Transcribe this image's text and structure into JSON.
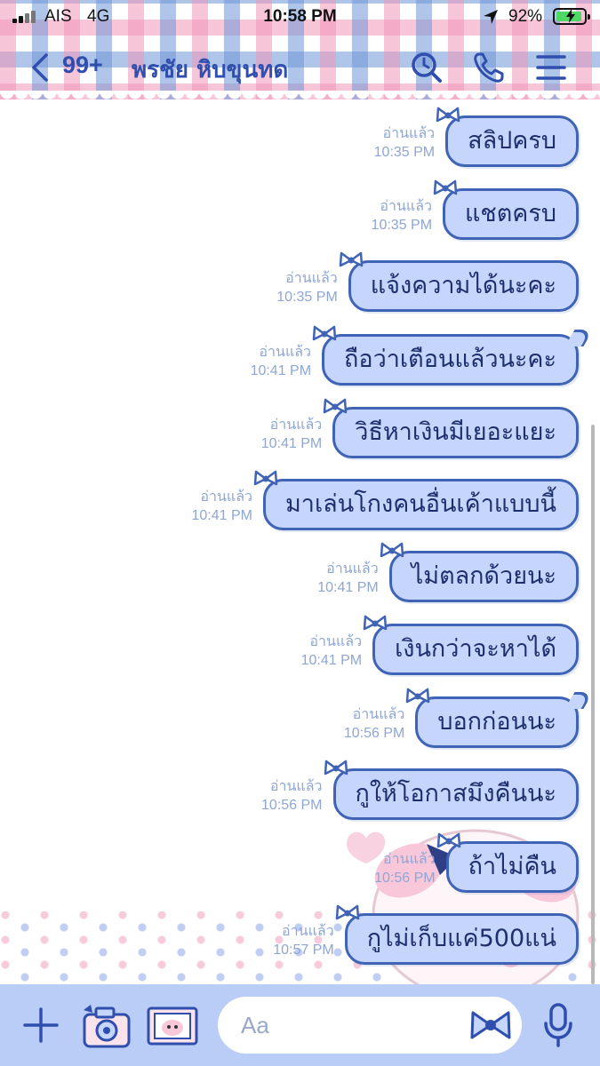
{
  "status_bar": {
    "carrier": "AIS",
    "network": "4G",
    "time": "10:58 PM",
    "battery": "92%",
    "battery_level": 0.92
  },
  "header": {
    "unread_count": "99+",
    "chat_title": "พรชัย หิบขุนทด"
  },
  "messages": [
    {
      "status": "อ่านแล้ว",
      "time": "10:35 PM",
      "text": "สลิปครบ"
    },
    {
      "status": "อ่านแล้ว",
      "time": "10:35 PM",
      "text": "แชตครบ"
    },
    {
      "status": "อ่านแล้ว",
      "time": "10:35 PM",
      "text": "แจ้งความได้นะคะ"
    },
    {
      "status": "อ่านแล้ว",
      "time": "10:41 PM",
      "text": "ถือว่าเตือนแล้วนะคะ"
    },
    {
      "status": "อ่านแล้ว",
      "time": "10:41 PM",
      "text": "วิธีหาเงินมีเยอะแยะ"
    },
    {
      "status": "อ่านแล้ว",
      "time": "10:41 PM",
      "text": "มาเล่นโกงคนอื่นเค้าแบบนี้"
    },
    {
      "status": "อ่านแล้ว",
      "time": "10:41 PM",
      "text": "ไม่ตลกด้วยนะ"
    },
    {
      "status": "อ่านแล้ว",
      "time": "10:41 PM",
      "text": "เงินกว่าจะหาได้"
    },
    {
      "status": "อ่านแล้ว",
      "time": "10:56 PM",
      "text": "บอกก่อนนะ"
    },
    {
      "status": "อ่านแล้ว",
      "time": "10:56 PM",
      "text": "กูให้โอกาสมึงคืนนะ"
    },
    {
      "status": "อ่านแล้ว",
      "time": "10:56 PM",
      "text": "ถ้าไม่คืน"
    },
    {
      "status": "อ่านแล้ว",
      "time": "10:57 PM",
      "text": "กูไม่เก็บแค่500แน่"
    }
  ],
  "input": {
    "placeholder": "Aa"
  },
  "colors": {
    "bubble_fill": "#c6d5fb",
    "bubble_border": "#3f63b5",
    "nav_text": "#2f4eae",
    "input_bar": "#b9cdf6"
  },
  "icons": {
    "back": "chevron-left-icon",
    "search": "search-icon",
    "call": "phone-icon",
    "menu": "menu-icon",
    "plus": "plus-icon",
    "camera": "camera-icon",
    "photo": "photo-icon",
    "sticker": "bow-sticker-icon",
    "mic": "microphone-icon"
  }
}
